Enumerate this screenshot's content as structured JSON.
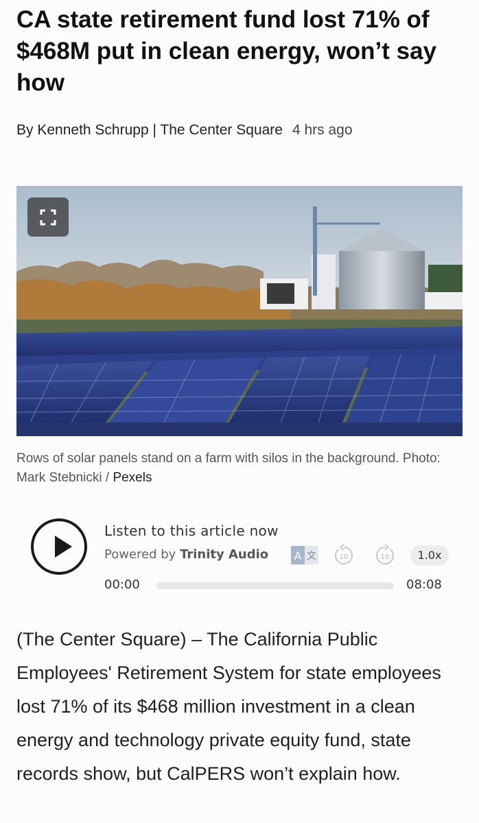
{
  "article": {
    "headline": "CA state retirement fund lost 71% of $468M put in clean energy, won’t say how",
    "byline": "By Kenneth Schrupp | The Center Square",
    "time_ago": "4 hrs ago"
  },
  "photo": {
    "fullscreen_icon": "expand-icon",
    "caption_text": "Rows of solar panels stand on a farm with silos in the background. Photo: Mark Stebnicki / ",
    "caption_link": "Pexels"
  },
  "audio_player": {
    "title": "Listen to this article now",
    "powered_by_prefix": "Powered by",
    "brand": "Trinity Audio",
    "skip_back_label": "10",
    "skip_forward_label": "10",
    "speed": "1.0x",
    "current_time": "00:00",
    "total_time": "08:08",
    "progress": 0
  },
  "body": {
    "paragraph_1": "(The Center Square) – The California Public Employees' Retirement System for state employees lost 71% of its $468 million investment in a clean energy and technology private equity fund, state records show, but CalPERS won’t explain how."
  }
}
